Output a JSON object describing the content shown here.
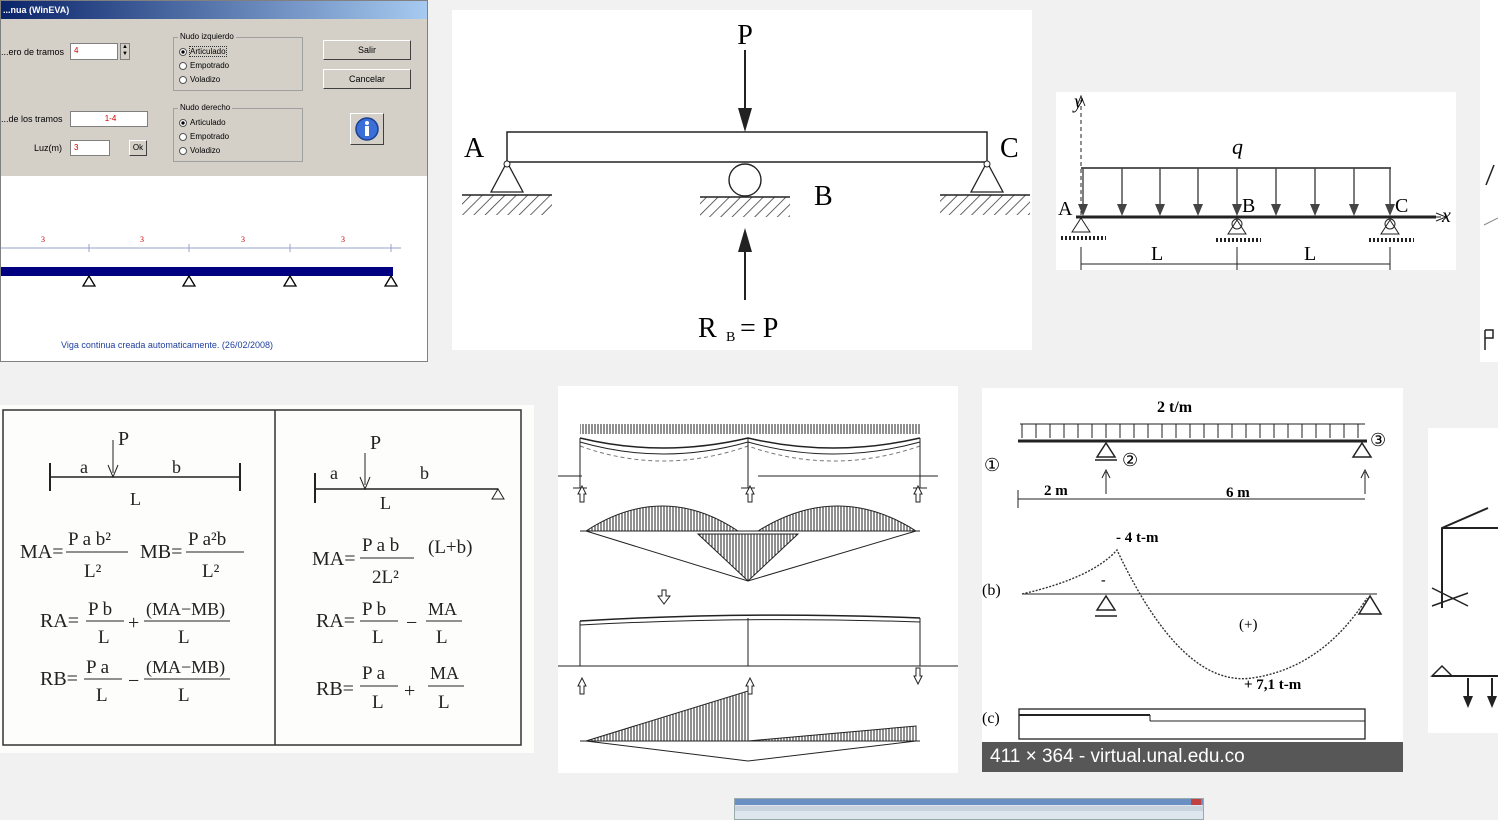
{
  "wineva": {
    "title": "...nua (WinEVA)",
    "num_spans_label": "...ero de tramos",
    "num_spans_value": "4",
    "left_node_title": "Nudo izquierdo",
    "right_node_title": "Nudo derecho",
    "node_options": [
      "Articulado",
      "Empotrado",
      "Voladizo"
    ],
    "left_selected": "Articulado",
    "right_selected": "Articulado",
    "spans_label": "...de los tramos",
    "spans_value": "1-4",
    "length_label": "Luz(m)",
    "length_value": "3",
    "ok_label": "Ok",
    "exit_label": "Salir",
    "cancel_label": "Cancelar",
    "span_labels": [
      "3",
      "3",
      "3",
      "3"
    ],
    "status_text": "Viga continua creada automaticamente.   (26/02/2008)",
    "colors": {
      "beam": "#000080",
      "title_bar": "#0a246a",
      "field_text": "#cc0000"
    }
  },
  "beam_pb": {
    "load": "P",
    "left": "A",
    "right": "C",
    "middle": "B",
    "reaction": "R",
    "reaction_sub": "B",
    "reaction_rhs": "= P"
  },
  "beam_q": {
    "y_axis": "y",
    "x_axis": "x",
    "load": "q",
    "a": "A",
    "b": "B",
    "c": "C",
    "span1": "L",
    "span2": "L"
  },
  "formulas": {
    "left": {
      "load": "P",
      "a": "a",
      "b": "b",
      "L": "L",
      "ma": "MA=",
      "ma_num": "P a b²",
      "ma_den": "L²",
      "mb": "MB=",
      "mb_num": "P a²b",
      "mb_den": "L²",
      "ra": "RA=",
      "ra_t1_num": "P b",
      "ra_t1_den": "L",
      "ra_op": "+",
      "ra_t2_num": "(MA−MB)",
      "ra_t2_den": "L",
      "rb": "RB=",
      "rb_t1_num": "P a",
      "rb_t1_den": "L",
      "rb_op": "−",
      "rb_t2_num": "(MA−MB)",
      "rb_t2_den": "L"
    },
    "right": {
      "load": "P",
      "a": "a",
      "b": "b",
      "L": "L",
      "ma": "MA=",
      "ma_num": "P a b",
      "ma_den": "2L²",
      "ma_tail": "(L+b)",
      "ra": "RA=",
      "ra_t1_num": "P b",
      "ra_t1_den": "L",
      "ra_op": "−",
      "ra_t2_num": "MA",
      "ra_t2_den": "L",
      "rb": "RB=",
      "rb_t1_num": "P a",
      "rb_t1_den": "L",
      "rb_op": "+",
      "rb_t2_num": "MA",
      "rb_t2_den": "L"
    }
  },
  "moment_diagram": {
    "load_label": "2 t/m",
    "node1": "①",
    "node2": "②",
    "node3": "③",
    "dist1": "2 m",
    "dist2": "6 m",
    "row_b": "(b)",
    "row_c": "(c)",
    "neg_moment": "- 4 t-m",
    "minus": "-",
    "plus": "(+)",
    "pos_moment": "+ 7,1 t-m"
  },
  "caption": "411 × 364 - virtual.unal.edu.co"
}
